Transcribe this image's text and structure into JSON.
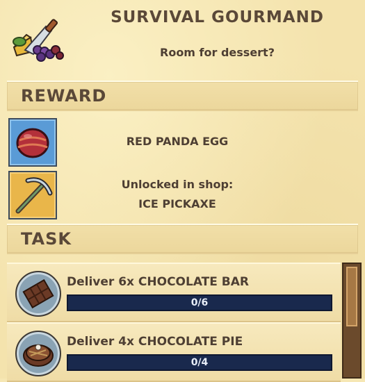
{
  "quest": {
    "title": "SURVIVAL GOURMAND",
    "subtitle": "Room for dessert?",
    "icon": "knife-and-grapes-icon"
  },
  "reward": {
    "heading": "REWARD",
    "items": [
      {
        "label": "RED PANDA EGG",
        "icon": "red-panda-egg-icon"
      },
      {
        "label_line1": "Unlocked in shop:",
        "label_line2": "ICE PICKAXE",
        "icon": "ice-pickaxe-icon"
      }
    ]
  },
  "task": {
    "heading": "TASK",
    "items": [
      {
        "label": "Deliver 6x CHOCOLATE BAR",
        "progress_text": "0/6",
        "progress": 0,
        "icon": "chocolate-bar-icon"
      },
      {
        "label": "Deliver 4x CHOCOLATE PIE",
        "progress_text": "0/4",
        "progress": 0,
        "icon": "chocolate-pie-icon"
      }
    ]
  },
  "colors": {
    "panel": "#f4e3ad",
    "progress_track": "#19294d",
    "text": "#4e3f33",
    "scrollbar": "#6b4a2c"
  }
}
